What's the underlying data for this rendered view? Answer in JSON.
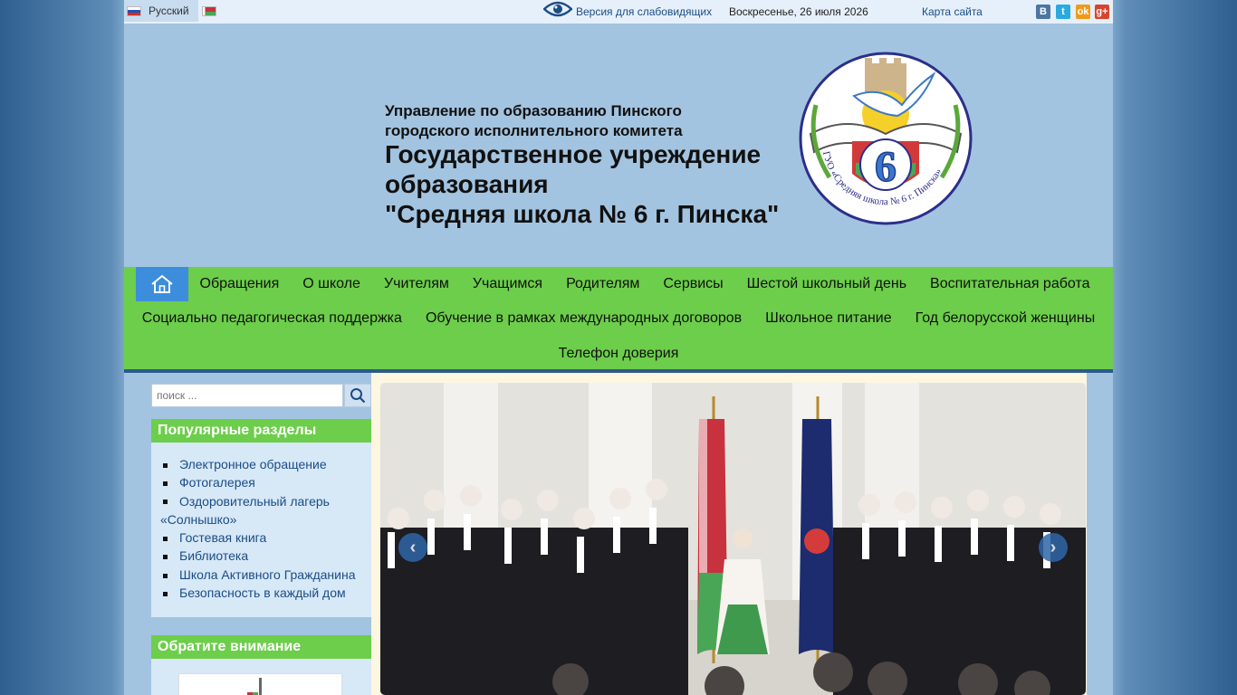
{
  "topbar": {
    "lang_ru": "Русский",
    "low_vision": "Версия для слабовидящих",
    "date": "Воскресенье, 26 июля 2026",
    "sitemap": "Карта сайта",
    "social": [
      "В",
      "t",
      "ok",
      "g+"
    ]
  },
  "header": {
    "subtitle": "Управление по образованию Пинского городского исполнительного комитета",
    "title_line1": "Государственное учреждение образования",
    "title_line2": "\"Средняя школа № 6 г. Пинска\"",
    "logo_text": "ГУО «Средняя школа № 6 г. Пинска»",
    "logo_number": "6"
  },
  "nav": {
    "row1": [
      "Обращения",
      "О школе",
      "Учителям",
      "Учащимся",
      "Родителям",
      "Сервисы",
      "Шестой школьный день",
      "Воспитательная работа"
    ],
    "row2": [
      "Социально педагогическая поддержка",
      "Обучение в рамках международных договоров",
      "Школьное питание",
      "Год белорусской женщины"
    ],
    "row3": [
      "Телефон доверия"
    ]
  },
  "sidebar": {
    "search_placeholder": "поиск ...",
    "popular_title": "Популярные разделы",
    "popular_items": [
      "Электронное обращение",
      "Фотогалерея",
      "Оздоровительный лагерь «Солнышко»",
      "Гостевая книга",
      "Библиотека",
      "Школа Активного Гражданина",
      "Безопасность в каждый дом"
    ],
    "attention_title": "Обратите внимание"
  },
  "slider": {
    "prev": "‹",
    "next": "›"
  },
  "colors": {
    "header_bg": "#a3c4e0",
    "nav_bg": "#6cce4a",
    "link": "#1b4d85",
    "home_btn": "#3c8ddb"
  }
}
